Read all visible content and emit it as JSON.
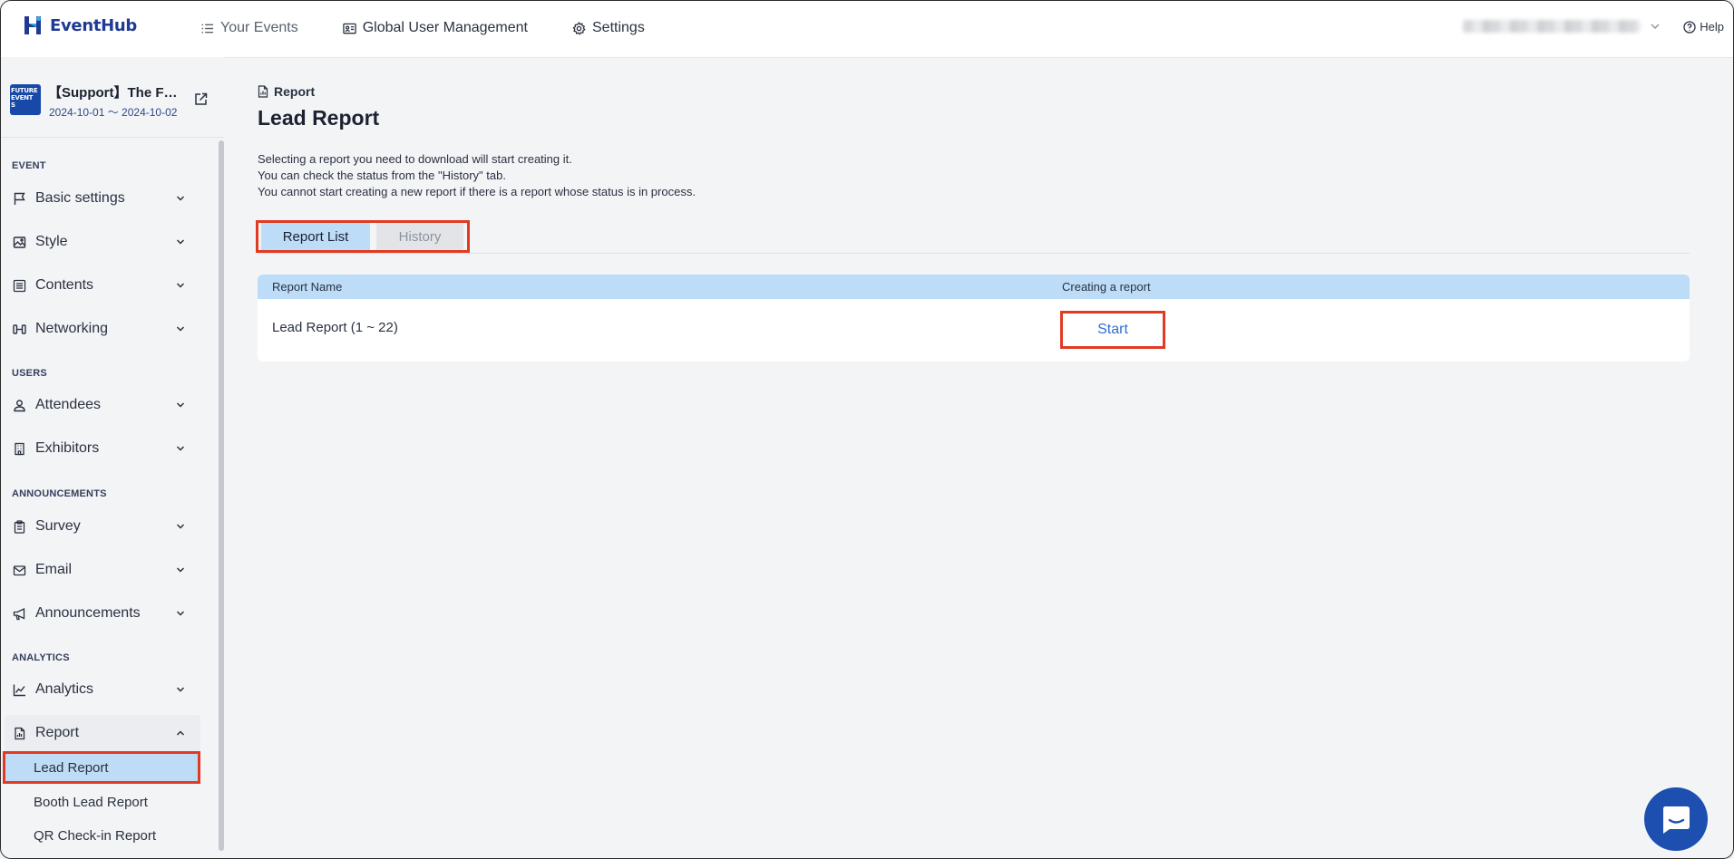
{
  "app": {
    "brand": "EventHub",
    "colors": {
      "brand": "#1f3a93",
      "accent_blue": "#2f6fd6",
      "active_bg": "#bcdcf7",
      "highlight_red": "#e23a22",
      "chat_fab": "#1c4fb0"
    }
  },
  "topnav": {
    "items": [
      {
        "label": "Your Events",
        "icon": "list-icon"
      },
      {
        "label": "Global User Management",
        "icon": "id-card-icon"
      },
      {
        "label": "Settings",
        "icon": "gear-icon"
      }
    ],
    "help_label": "Help"
  },
  "event": {
    "title": "【Support】The F…",
    "dates": "2024-10-01 〜 2024-10-02",
    "thumb_lines": [
      "FUTURE",
      "EVENT",
      "S"
    ]
  },
  "sidebar": {
    "sections": [
      {
        "title": "EVENT",
        "items": [
          {
            "label": "Basic settings",
            "icon": "flag-icon"
          },
          {
            "label": "Style",
            "icon": "image-icon"
          },
          {
            "label": "Contents",
            "icon": "list-box-icon"
          },
          {
            "label": "Networking",
            "icon": "network-icon"
          }
        ]
      },
      {
        "title": "USERS",
        "items": [
          {
            "label": "Attendees",
            "icon": "user-icon"
          },
          {
            "label": "Exhibitors",
            "icon": "building-icon"
          }
        ]
      },
      {
        "title": "ANNOUNCEMENTS",
        "items": [
          {
            "label": "Survey",
            "icon": "clipboard-icon"
          },
          {
            "label": "Email",
            "icon": "mail-icon"
          },
          {
            "label": "Announcements",
            "icon": "megaphone-icon"
          }
        ]
      },
      {
        "title": "ANALYTICS",
        "items": [
          {
            "label": "Analytics",
            "icon": "chart-line-icon"
          },
          {
            "label": "Report",
            "icon": "report-icon"
          }
        ]
      }
    ],
    "report_sub_items": [
      "Lead Report",
      "Booth Lead Report",
      "QR Check-in Report"
    ],
    "active_sub_item": "Lead Report"
  },
  "main": {
    "breadcrumb": "Report",
    "title": "Lead Report",
    "description": [
      "Selecting a report you need to download will start creating it.",
      "You can check the status from the \"History\" tab.",
      "You cannot start creating a new report if there is a report whose status is in process."
    ],
    "tabs": [
      {
        "label": "Report List",
        "active": true
      },
      {
        "label": "History",
        "active": false
      }
    ],
    "table": {
      "headers": [
        "Report Name",
        "Creating a report"
      ],
      "rows": [
        {
          "name": "Lead Report (1 ~ 22)",
          "action": "Start"
        }
      ]
    }
  }
}
